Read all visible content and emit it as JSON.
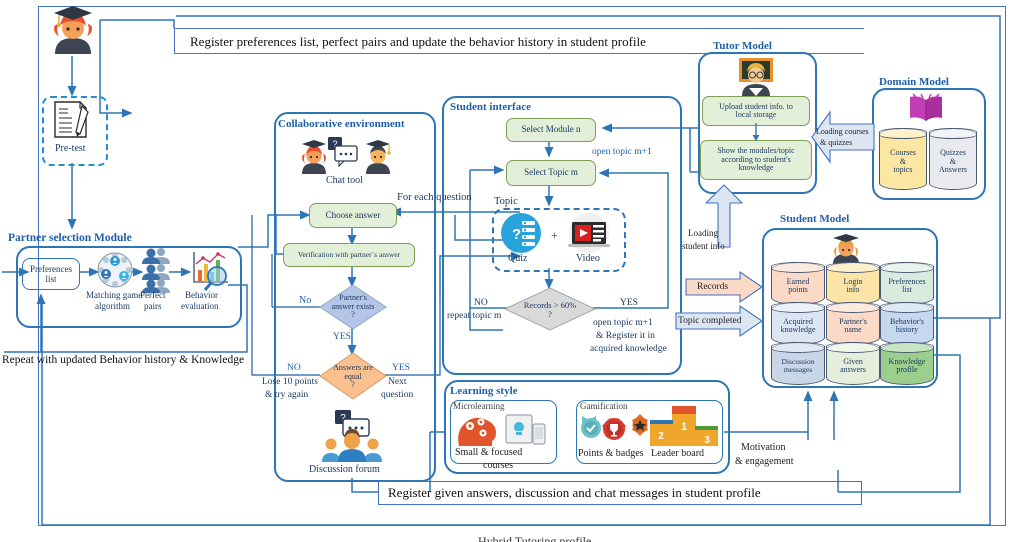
{
  "diagram": {
    "title_cut": "Hybrid Tutoring profile",
    "top_note": "Register preferences list, perfect pairs and update the behavior history in student profile",
    "bottom_note": "Register given answers, discussion and chat messages in student profile",
    "repeat_note": "Repeat with updated Behavior history & Knowledge"
  },
  "student_actor": {
    "label": "",
    "icon": "graduate-student-icon"
  },
  "pretest": {
    "label": "Pre-test",
    "icon": "test-paper-icon"
  },
  "partner_module": {
    "title": "Partner selection Module",
    "preferences_list": "Preferences\nlist",
    "preferences_list_line1": "Preferences",
    "preferences_list_line2": "list",
    "matching_game": "Matching game",
    "matching_game2": "algorithm",
    "perfect_pairs": "Perfect",
    "perfect_pairs2": "pairs",
    "behavior_eval": "Behavior",
    "behavior_eval2": "evaluation",
    "icons": [
      "network-users-icon",
      "user-pairs-icon",
      "chart-magnifier-icon"
    ]
  },
  "collaborative": {
    "title": "Collaborative environment",
    "chat_tool": "Chat tool",
    "choose_answer": "Choose answer",
    "verification": "Verification with partner`s answer",
    "partner_exists": "Partner's\nanswer exists\n?",
    "partner_exists_l1": "Partner's",
    "partner_exists_l2": "answer exists",
    "partner_exists_l3": "?",
    "no_label": "No",
    "yes_label": "YES",
    "answers_equal_l1": "Answers are",
    "answers_equal_l2": "equal",
    "answers_equal_l3": "?",
    "eq_no": "NO",
    "eq_yes": "YES",
    "lose_points_l1": "Lose 10 points",
    "lose_points_l2": "& try again",
    "next_question_l1": "Next",
    "next_question_l2": "question",
    "discussion_forum": "Discussion forum",
    "for_each_question": "For each question"
  },
  "student_interface": {
    "title": "Student interface",
    "select_module": "Select Module n",
    "select_topic": "Select Topic m",
    "open_topic": "open topic m+1",
    "topic_label": "Topic",
    "quiz": "Quiz",
    "video": "Video",
    "plus": "+",
    "records_l1": "Records > 60%",
    "records_l2": "?",
    "no_l1": "NO",
    "no_l2": "repeat topic m",
    "yes_l1": "YES",
    "yes_l2": "open topic m+1",
    "yes_l3": "& Register it in",
    "yes_l4": "acquired knowledge"
  },
  "learning_style": {
    "title": "Learning style",
    "microlearning": "Microlearning",
    "micro_caption_l1": "Small & focused",
    "micro_caption_l2": "courses",
    "gamification": "Gamification",
    "points_badges": "Points & badges",
    "leader_board": "Leader board",
    "leader_numbers": [
      "2",
      "1",
      "3"
    ],
    "motivation_l1": "Motivation",
    "motivation_l2": "& engagement"
  },
  "tutor_model": {
    "title": "Tutor Model",
    "upload_l1": "Upload student info. to",
    "upload_l2": "local storage",
    "show_l1": "Show the modules/topic",
    "show_l2": "according to student's",
    "show_l3": "knowledge",
    "loading_student_l1": "Loading",
    "loading_student_l2": "student info",
    "icon": "teacher-board-icon"
  },
  "domain_model": {
    "title": "Domain Model",
    "loading_courses_l1": "Loading courses",
    "loading_courses_l2": "& quizzes",
    "cylinders": [
      {
        "l1": "Courses",
        "l2": "&",
        "l3": "topics",
        "color": "#FBE7A1"
      },
      {
        "l1": "Quizzes",
        "l2": "&",
        "l3": "Answers",
        "color": "#E8EAF0"
      }
    ],
    "icon": "open-book-icon"
  },
  "student_model": {
    "title": "Student Model",
    "records_arrow": "Records",
    "topic_completed_arrow": "Topic completed",
    "icon": "graduate-student-icon",
    "cylinders": [
      {
        "l1": "Earned",
        "l2": "points",
        "color": "#FAD9C6"
      },
      {
        "l1": "Login",
        "l2": "info",
        "color": "#FCE4A6"
      },
      {
        "l1": "Preferences",
        "l2": "list",
        "color": "#D9EADF"
      },
      {
        "l1": "Acquired",
        "l2": "knowledge",
        "color": "#DCE6F2"
      },
      {
        "l1": "Partner's",
        "l2": "name",
        "color": "#FAD9C6"
      },
      {
        "l1": "Behavior's",
        "l2": "history",
        "color": "#C5D8EF"
      },
      {
        "l1": "Discussion",
        "l2": "messages",
        "color": "#C9D6E8"
      },
      {
        "l1": "Given",
        "l2": "answers",
        "color": "#E5EEDB"
      },
      {
        "l1": "Knowledge",
        "l2": "profile",
        "color": "#9CCF8E"
      }
    ]
  },
  "colors": {
    "blue_border": "#2E75B6",
    "title_blue": "#1F5FA9",
    "green_fill": "#E2EFD9",
    "diamond_blue": "#B4C6E7",
    "diamond_orange": "#FAC090",
    "diamond_grey": "#D9D9D9",
    "arrow_fill": "#DCE6F2",
    "records_fill": "#FAD9C6"
  }
}
